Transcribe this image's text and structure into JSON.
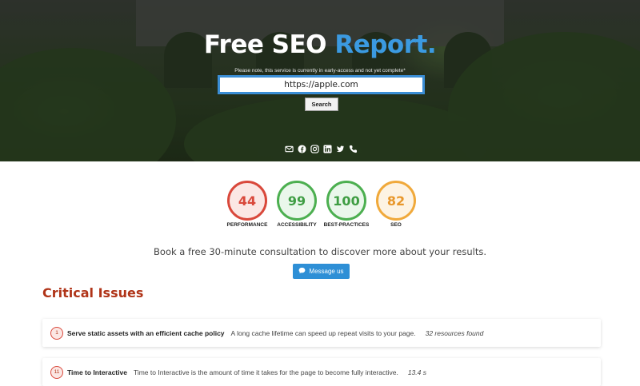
{
  "hero": {
    "title_main": "Free SEO ",
    "title_accent": "Report.",
    "note": "Please note, this service is currently in early-access and not yet complete*",
    "url_value": "https://apple.com",
    "search_label": "Search",
    "accent_color": "#3b9ae1",
    "social_icons": [
      "mail-icon",
      "facebook-icon",
      "instagram-icon",
      "linkedin-icon",
      "twitter-icon",
      "phone-icon"
    ]
  },
  "scores": [
    {
      "value": "44",
      "label": "PERFORMANCE",
      "color": "#d9483b",
      "bg": "#fbe7e4"
    },
    {
      "value": "99",
      "label": "ACCESSIBILITY",
      "color": "#4caf50",
      "bg": "#eaf7eb"
    },
    {
      "value": "100",
      "label": "BEST-PRACTICES",
      "color": "#4caf50",
      "bg": "#eaf7eb"
    },
    {
      "value": "82",
      "label": "SEO",
      "color": "#f0a93b",
      "bg": "#fdf3e3"
    }
  ],
  "consult": {
    "text": "Book a free 30-minute consultation to discover more about your results.",
    "button_label": "Message us",
    "button_color": "#2e8fd6"
  },
  "critical": {
    "title": "Critical Issues",
    "title_color": "#b03418",
    "issues": [
      {
        "number": "1",
        "title": "Serve static assets with an efficient cache policy",
        "description": "A long cache lifetime can speed up repeat visits to your page.",
        "metric": "32 resources found"
      },
      {
        "number": "11",
        "title": "Time to Interactive",
        "description": "Time to Interactive is the amount of time it takes for the page to become fully interactive.",
        "metric": "13.4 s"
      }
    ]
  }
}
